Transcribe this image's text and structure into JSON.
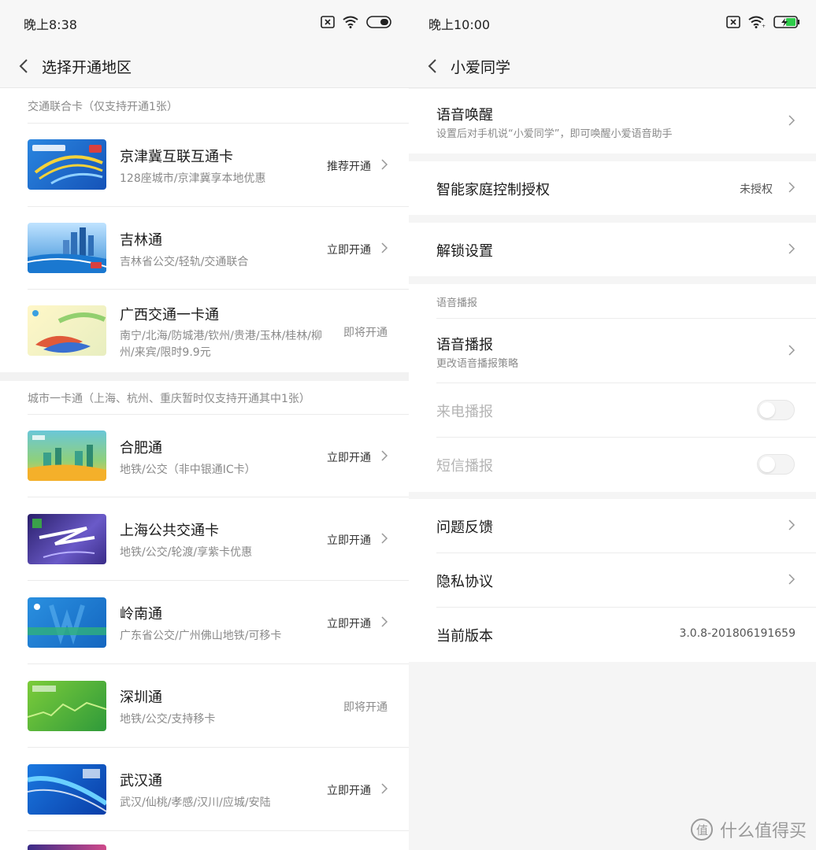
{
  "left": {
    "status_time": "晚上8:38",
    "title": "选择开通地区",
    "section1_label": "交通联合卡（仅支持开通1张）",
    "section2_label": "城市一卡通（上海、杭州、重庆暂时仅支持开通其中1张）",
    "cards": [
      {
        "title": "京津冀互联互通卡",
        "desc": "128座城市/京津冀享本地优惠",
        "action": "推荐开通"
      },
      {
        "title": "吉林通",
        "desc": "吉林省公交/轻轨/交通联合",
        "action": "立即开通"
      },
      {
        "title": "广西交通一卡通",
        "desc": "南宁/北海/防城港/钦州/贵港/玉林/桂林/柳州/来宾/限时9.9元",
        "action": "即将开通"
      },
      {
        "title": "合肥通",
        "desc": "地铁/公交（非中银通IC卡）",
        "action": "立即开通"
      },
      {
        "title": "上海公共交通卡",
        "desc": "地铁/公交/轮渡/享紫卡优惠",
        "action": "立即开通"
      },
      {
        "title": "岭南通",
        "desc": "广东省公交/广州佛山地铁/可移卡",
        "action": "立即开通"
      },
      {
        "title": "深圳通",
        "desc": "地铁/公交/支持移卡",
        "action": "即将开通"
      },
      {
        "title": "武汉通",
        "desc": "武汉/仙桃/孝感/汉川/应城/安陆",
        "action": "立即开通"
      }
    ],
    "card_colors": [
      "#1f6fd1",
      "#3a8fd8",
      "#f1e9a0",
      "#4aa86a",
      "#4a3a9a",
      "#1e88d6",
      "#4cae3a",
      "#1a66c8"
    ]
  },
  "right": {
    "status_time": "晚上10:00",
    "title": "小爱同学",
    "voice_wake_title": "语音唤醒",
    "voice_wake_sub": "设置后对手机说“小爱同学”，即可唤醒小爱语音助手",
    "smart_home_title": "智能家庭控制授权",
    "smart_home_value": "未授权",
    "unlock_title": "解锁设置",
    "broadcast_section": "语音播报",
    "broadcast_title": "语音播报",
    "broadcast_sub": "更改语音播报策略",
    "call_broadcast": "来电播报",
    "sms_broadcast": "短信播报",
    "feedback": "问题反馈",
    "privacy": "隐私协议",
    "version_title": "当前版本",
    "version_value": "3.0.8-201806191659"
  },
  "watermark": "什么值得买",
  "icons": {
    "back": "chevron-left-icon",
    "forward": "chevron-right-icon",
    "sim": "sim-card-icon",
    "wifi": "wifi-icon",
    "battery": "battery-icon"
  }
}
